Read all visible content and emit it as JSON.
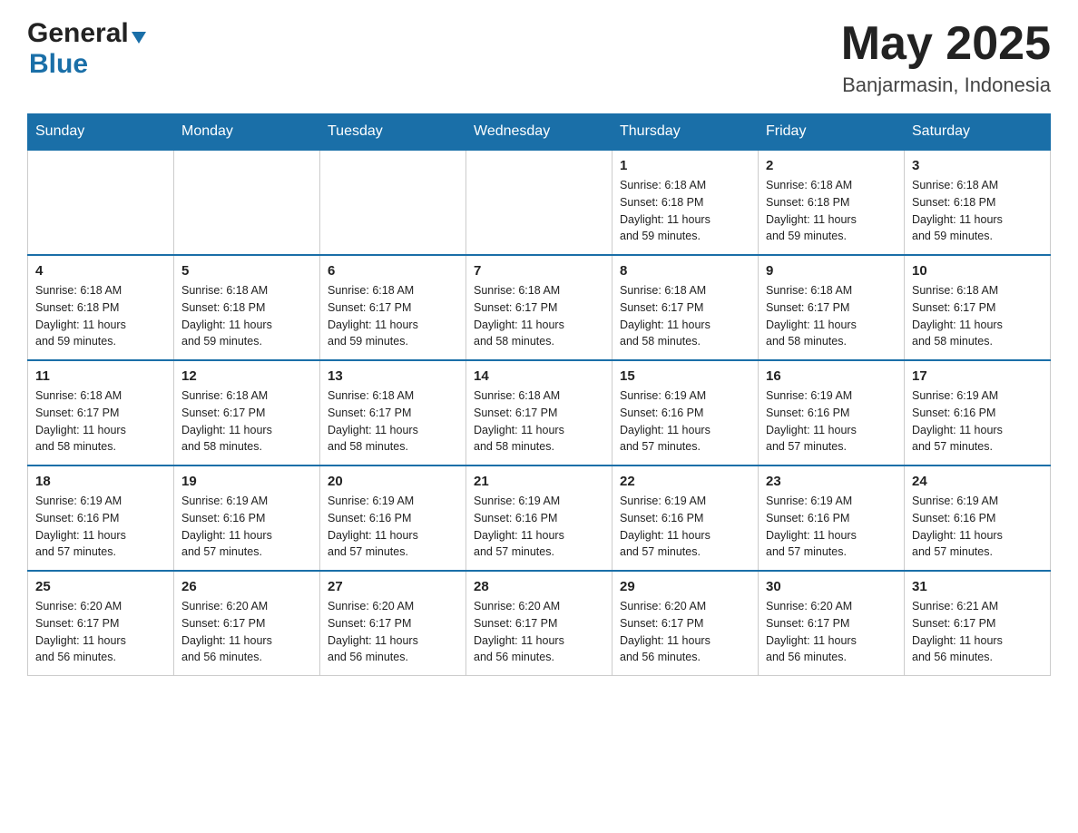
{
  "header": {
    "logo": {
      "general": "General",
      "blue": "Blue",
      "triangle": "▶"
    },
    "title": "May 2025",
    "location": "Banjarmasin, Indonesia"
  },
  "calendar": {
    "days_of_week": [
      "Sunday",
      "Monday",
      "Tuesday",
      "Wednesday",
      "Thursday",
      "Friday",
      "Saturday"
    ],
    "weeks": [
      [
        {
          "day": "",
          "info": ""
        },
        {
          "day": "",
          "info": ""
        },
        {
          "day": "",
          "info": ""
        },
        {
          "day": "",
          "info": ""
        },
        {
          "day": "1",
          "info": "Sunrise: 6:18 AM\nSunset: 6:18 PM\nDaylight: 11 hours\nand 59 minutes."
        },
        {
          "day": "2",
          "info": "Sunrise: 6:18 AM\nSunset: 6:18 PM\nDaylight: 11 hours\nand 59 minutes."
        },
        {
          "day": "3",
          "info": "Sunrise: 6:18 AM\nSunset: 6:18 PM\nDaylight: 11 hours\nand 59 minutes."
        }
      ],
      [
        {
          "day": "4",
          "info": "Sunrise: 6:18 AM\nSunset: 6:18 PM\nDaylight: 11 hours\nand 59 minutes."
        },
        {
          "day": "5",
          "info": "Sunrise: 6:18 AM\nSunset: 6:18 PM\nDaylight: 11 hours\nand 59 minutes."
        },
        {
          "day": "6",
          "info": "Sunrise: 6:18 AM\nSunset: 6:17 PM\nDaylight: 11 hours\nand 59 minutes."
        },
        {
          "day": "7",
          "info": "Sunrise: 6:18 AM\nSunset: 6:17 PM\nDaylight: 11 hours\nand 58 minutes."
        },
        {
          "day": "8",
          "info": "Sunrise: 6:18 AM\nSunset: 6:17 PM\nDaylight: 11 hours\nand 58 minutes."
        },
        {
          "day": "9",
          "info": "Sunrise: 6:18 AM\nSunset: 6:17 PM\nDaylight: 11 hours\nand 58 minutes."
        },
        {
          "day": "10",
          "info": "Sunrise: 6:18 AM\nSunset: 6:17 PM\nDaylight: 11 hours\nand 58 minutes."
        }
      ],
      [
        {
          "day": "11",
          "info": "Sunrise: 6:18 AM\nSunset: 6:17 PM\nDaylight: 11 hours\nand 58 minutes."
        },
        {
          "day": "12",
          "info": "Sunrise: 6:18 AM\nSunset: 6:17 PM\nDaylight: 11 hours\nand 58 minutes."
        },
        {
          "day": "13",
          "info": "Sunrise: 6:18 AM\nSunset: 6:17 PM\nDaylight: 11 hours\nand 58 minutes."
        },
        {
          "day": "14",
          "info": "Sunrise: 6:18 AM\nSunset: 6:17 PM\nDaylight: 11 hours\nand 58 minutes."
        },
        {
          "day": "15",
          "info": "Sunrise: 6:19 AM\nSunset: 6:16 PM\nDaylight: 11 hours\nand 57 minutes."
        },
        {
          "day": "16",
          "info": "Sunrise: 6:19 AM\nSunset: 6:16 PM\nDaylight: 11 hours\nand 57 minutes."
        },
        {
          "day": "17",
          "info": "Sunrise: 6:19 AM\nSunset: 6:16 PM\nDaylight: 11 hours\nand 57 minutes."
        }
      ],
      [
        {
          "day": "18",
          "info": "Sunrise: 6:19 AM\nSunset: 6:16 PM\nDaylight: 11 hours\nand 57 minutes."
        },
        {
          "day": "19",
          "info": "Sunrise: 6:19 AM\nSunset: 6:16 PM\nDaylight: 11 hours\nand 57 minutes."
        },
        {
          "day": "20",
          "info": "Sunrise: 6:19 AM\nSunset: 6:16 PM\nDaylight: 11 hours\nand 57 minutes."
        },
        {
          "day": "21",
          "info": "Sunrise: 6:19 AM\nSunset: 6:16 PM\nDaylight: 11 hours\nand 57 minutes."
        },
        {
          "day": "22",
          "info": "Sunrise: 6:19 AM\nSunset: 6:16 PM\nDaylight: 11 hours\nand 57 minutes."
        },
        {
          "day": "23",
          "info": "Sunrise: 6:19 AM\nSunset: 6:16 PM\nDaylight: 11 hours\nand 57 minutes."
        },
        {
          "day": "24",
          "info": "Sunrise: 6:19 AM\nSunset: 6:16 PM\nDaylight: 11 hours\nand 57 minutes."
        }
      ],
      [
        {
          "day": "25",
          "info": "Sunrise: 6:20 AM\nSunset: 6:17 PM\nDaylight: 11 hours\nand 56 minutes."
        },
        {
          "day": "26",
          "info": "Sunrise: 6:20 AM\nSunset: 6:17 PM\nDaylight: 11 hours\nand 56 minutes."
        },
        {
          "day": "27",
          "info": "Sunrise: 6:20 AM\nSunset: 6:17 PM\nDaylight: 11 hours\nand 56 minutes."
        },
        {
          "day": "28",
          "info": "Sunrise: 6:20 AM\nSunset: 6:17 PM\nDaylight: 11 hours\nand 56 minutes."
        },
        {
          "day": "29",
          "info": "Sunrise: 6:20 AM\nSunset: 6:17 PM\nDaylight: 11 hours\nand 56 minutes."
        },
        {
          "day": "30",
          "info": "Sunrise: 6:20 AM\nSunset: 6:17 PM\nDaylight: 11 hours\nand 56 minutes."
        },
        {
          "day": "31",
          "info": "Sunrise: 6:21 AM\nSunset: 6:17 PM\nDaylight: 11 hours\nand 56 minutes."
        }
      ]
    ]
  }
}
